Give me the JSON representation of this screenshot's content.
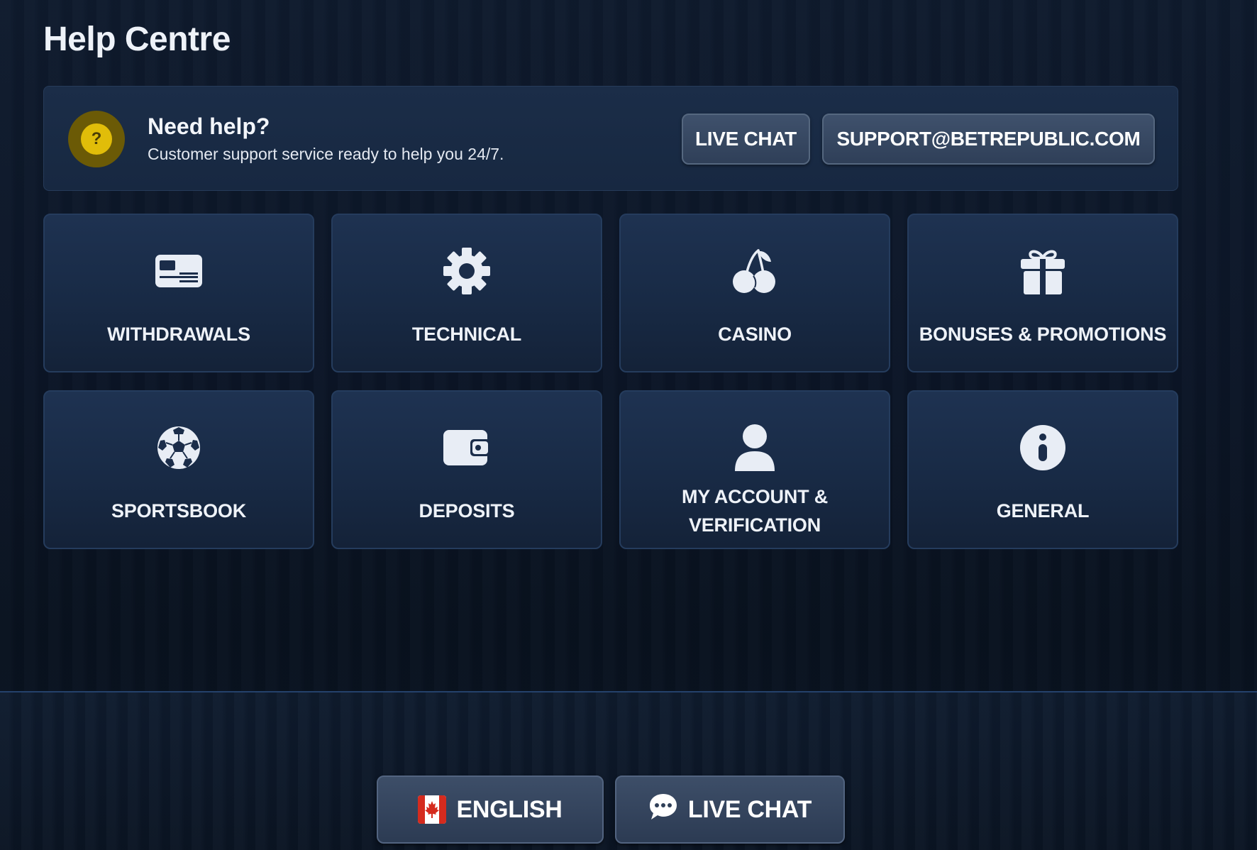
{
  "page": {
    "title": "Help Centre"
  },
  "help_panel": {
    "icon": "question-icon",
    "icon_glyph": "?",
    "heading": "Need help?",
    "subtext": "Customer support service ready to help you 24/7.",
    "live_chat_label": "LIVE CHAT",
    "email_label": "SUPPORT@BETREPUBLIC.COM"
  },
  "categories": [
    {
      "label": "WITHDRAWALS",
      "icon": "card-icon"
    },
    {
      "label": "TECHNICAL",
      "icon": "gear-icon"
    },
    {
      "label": "CASINO",
      "icon": "cherries-icon"
    },
    {
      "label": "BONUSES & PROMOTIONS",
      "icon": "gift-icon"
    },
    {
      "label": "SPORTSBOOK",
      "icon": "soccer-ball-icon"
    },
    {
      "label": "DEPOSITS",
      "icon": "wallet-icon"
    },
    {
      "label": "MY ACCOUNT & VERIFICATION",
      "icon": "user-icon"
    },
    {
      "label": "GENERAL",
      "icon": "info-icon"
    }
  ],
  "footer": {
    "language_label": "ENGLISH",
    "language_flag": "canada-flag-icon",
    "live_chat_label": "LIVE CHAT",
    "live_chat_icon": "chat-bubble-icon"
  },
  "colors": {
    "background": "#0c1628",
    "panel": "#1b2d48",
    "accent_yellow": "#e1bd09",
    "button": "#3f516c",
    "text": "#eef2f8"
  }
}
